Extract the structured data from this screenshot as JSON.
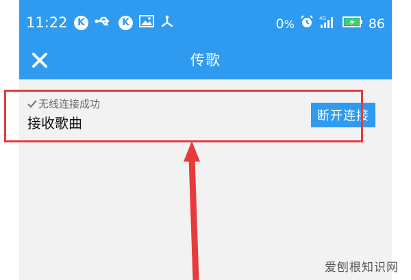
{
  "status_bar": {
    "time": "11:22",
    "k_badge": "K",
    "battery_percent": "0",
    "battery_level": "86",
    "icons_left": [
      "k-badge-icon",
      "usb-icon",
      "k-badge-icon",
      "image-icon",
      "share-icon"
    ],
    "icons_right": [
      "data-speed-icon",
      "alarm-icon",
      "4g-signal-icon",
      "battery-charging-icon"
    ]
  },
  "header": {
    "title": "传歌",
    "close_icon": "close-icon"
  },
  "connection": {
    "status_text": "无线连接成功",
    "status_icon": "checkmark-icon",
    "section_title": "接收歌曲",
    "disconnect_label": "断开连接"
  },
  "watermark": "爱刨根知识网",
  "colors": {
    "accent": "#2f9bf0",
    "highlight": "#e83a3a",
    "background": "#f2f2f2"
  }
}
